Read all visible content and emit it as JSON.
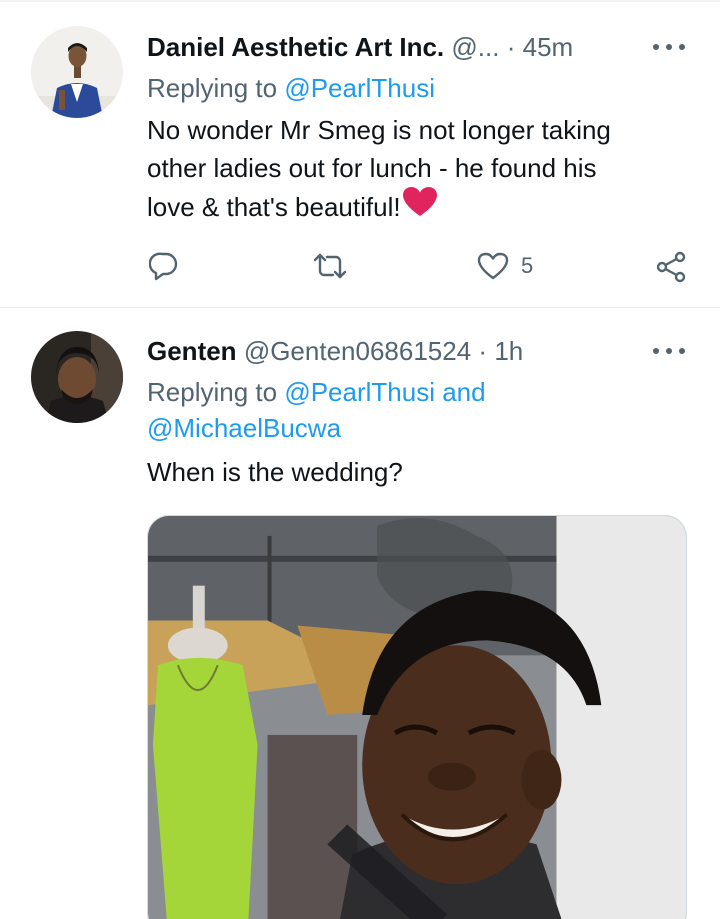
{
  "tweets": [
    {
      "author_name": "Daniel Aesthetic Art Inc.",
      "handle": "@...",
      "separator": "·",
      "time": "45m",
      "replying_prefix": "Replying to",
      "mentions": [
        "@PearlThusi"
      ],
      "text_lines": [
        "No wonder Mr Smeg is not longer taking",
        "other ladies out for lunch - he found his",
        "love & that's beautiful!"
      ],
      "text_emoji": "heart-emoji",
      "actions": {
        "reply_icon": "comment-icon",
        "retweet_icon": "retweet-icon",
        "like_icon": "heart-icon",
        "like_count": "5",
        "share_icon": "share-icon"
      }
    },
    {
      "author_name": "Genten",
      "handle": "@Genten06861524",
      "separator": "·",
      "time": "1h",
      "replying_prefix": "Replying to",
      "mentions": [
        "@PearlThusi",
        "@MichaelBucwa"
      ],
      "mention_joiner": "and",
      "text_lines": [
        "When is the wedding?"
      ],
      "media": "photo of a smiling man with short curly hair in front of a store window with a green dress on a mannequin"
    }
  ],
  "colors": {
    "text": "#0f1419",
    "secondary": "#536471",
    "link": "#1d9bf0",
    "heart": "#e0245e",
    "divider": "#e6ecf0"
  }
}
